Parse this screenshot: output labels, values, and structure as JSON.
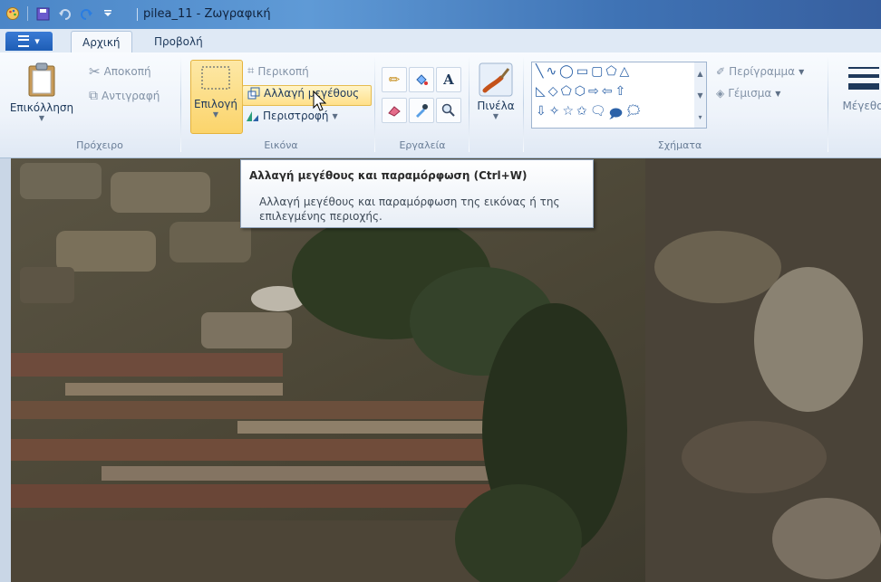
{
  "titlebar": {
    "title": "pilea_11 - Ζωγραφική",
    "quick_access": [
      "paint-app-icon",
      "save-icon",
      "undo-icon",
      "redo-icon",
      "customize-qat-icon"
    ]
  },
  "tabs": {
    "file_menu_icon": "file-menu-icon",
    "items": [
      {
        "label": "Αρχική",
        "active": true
      },
      {
        "label": "Προβολή",
        "active": false
      }
    ]
  },
  "ribbon": {
    "clipboard": {
      "group_label": "Πρόχειρο",
      "paste": "Επικόλληση",
      "cut": "Αποκοπή",
      "copy": "Αντιγραφή"
    },
    "image": {
      "group_label": "Εικόνα",
      "select": "Επιλογή",
      "crop": "Περικοπή",
      "resize": "Αλλαγή μεγέθους",
      "rotate": "Περιστροφή"
    },
    "tools": {
      "group_label": "Εργαλεία",
      "icons": [
        "pencil-icon",
        "fill-icon",
        "text-icon",
        "eraser-icon",
        "color-picker-icon",
        "magnifier-icon"
      ]
    },
    "brushes": {
      "label": "Πινέλα"
    },
    "shapes": {
      "group_label": "Σχήματα",
      "outline": "Περίγραμμα",
      "fill": "Γέμισμα",
      "rows": [
        [
          "╲",
          "∿",
          "◯",
          "▭",
          "▢",
          "⬠",
          "△"
        ],
        [
          "◺",
          "◇",
          "⬠",
          "⬡",
          "⇨",
          "⇦",
          "⇧"
        ],
        [
          "⇩",
          "✧",
          "☆",
          "✩",
          "🗨",
          "🗩",
          "🗯"
        ]
      ]
    },
    "size": {
      "label": "Μέγεθο"
    }
  },
  "tooltip": {
    "title": "Αλλαγή μεγέθους και παραμόρφωση (Ctrl+W)",
    "description": "Αλλαγή μεγέθους και παραμόρφωση της εικόνας ή της επιλεγμένης περιοχής."
  },
  "colors": {
    "accent": "#3a7bd5",
    "highlight": "#fbd46b",
    "titlebar": "#4b86c7"
  }
}
